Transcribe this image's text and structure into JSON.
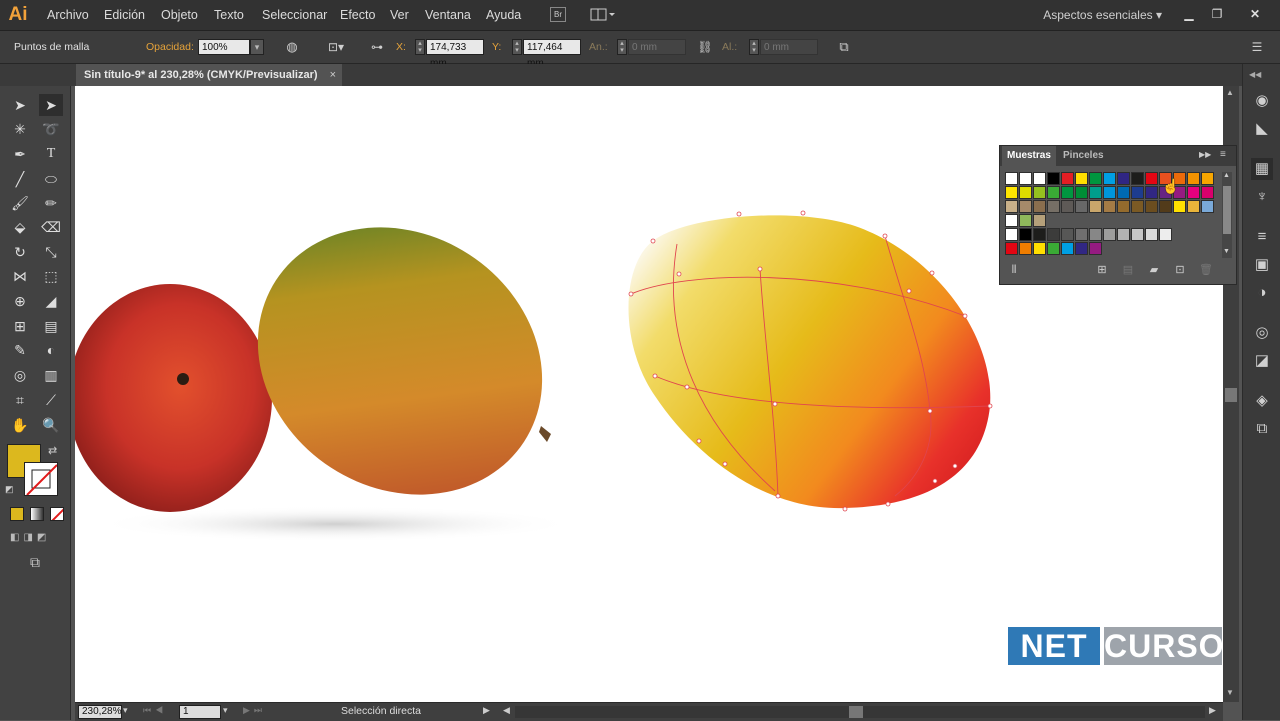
{
  "app": {
    "logo": "Ai",
    "brand_color": "#f2a23a"
  },
  "menubar": {
    "items": [
      "Archivo",
      "Edición",
      "Objeto",
      "Texto",
      "Seleccionar",
      "Efecto",
      "Ver",
      "Ventana",
      "Ayuda"
    ],
    "bridge_label": "Br",
    "workspace": "Aspectos esenciales",
    "window_controls": [
      "minimize-icon",
      "restore-icon",
      "close-icon"
    ]
  },
  "control_bar": {
    "selection_type": "Puntos de malla",
    "opacity_label": "Opacidad:",
    "opacity_value": "100%",
    "x_label": "X:",
    "x_value": "174,733 mm",
    "y_label": "Y:",
    "y_value": "117,464 mm",
    "w_label": "An.:",
    "w_value": "0 mm",
    "h_label": "Al.:",
    "h_value": "0 mm"
  },
  "document": {
    "tab_title": "Sin título-9* al 230,28% (CMYK/Previsualizar)",
    "close_glyph": "×"
  },
  "panel": {
    "tabs": [
      "Muestras",
      "Pinceles"
    ],
    "active_tab": "Muestras",
    "swatch_rows": [
      [
        "#ffffff",
        "#ffffff",
        "#ffffff",
        "#000000",
        "#e31e24",
        "#ffde00",
        "#00963f",
        "#009fe3",
        "#302683",
        "#1d1d1b",
        "#e30613",
        "#e9501e",
        "#ec6a0a",
        "#f39200",
        "#f7a600"
      ],
      [
        "#ffe500",
        "#dedc00",
        "#95c11f",
        "#3aaa35",
        "#009640",
        "#008d36",
        "#009e8c",
        "#0095db",
        "#006ab3",
        "#1d3c8f",
        "#312783",
        "#662483",
        "#951b81",
        "#e6007e",
        "#d9006c"
      ],
      [
        "#c8b089",
        "#a58a6a",
        "#8a6e4e",
        "#766f66",
        "#5e5a57",
        "#686868",
        "#c9a66b",
        "#a47b45",
        "#946b2d",
        "#7b5a24",
        "#6b4d1f",
        "#523b1a",
        "#ffe100",
        "#e9b43a",
        "#7aa9d8"
      ],
      [
        "#ffffff",
        "#8fb85b",
        "#b5a07a"
      ],
      [
        "#ffffff",
        "#000000",
        "#1d1d1b",
        "#3c3c3b",
        "#575756",
        "#706f6f",
        "#878787",
        "#9d9d9c",
        "#b2b2b2",
        "#c6c6c6",
        "#dadada",
        "#ededed"
      ],
      [
        "#e30613",
        "#ef7d00",
        "#ffde00",
        "#3aaa35",
        "#009fe3",
        "#312783",
        "#951b81"
      ]
    ]
  },
  "fill": {
    "color": "#dcb81e"
  },
  "status_bar": {
    "zoom": "230,28%",
    "page": "1",
    "tool_name": "Selección directa"
  },
  "watermark": {
    "left": "NET",
    "right": "CURSO"
  }
}
